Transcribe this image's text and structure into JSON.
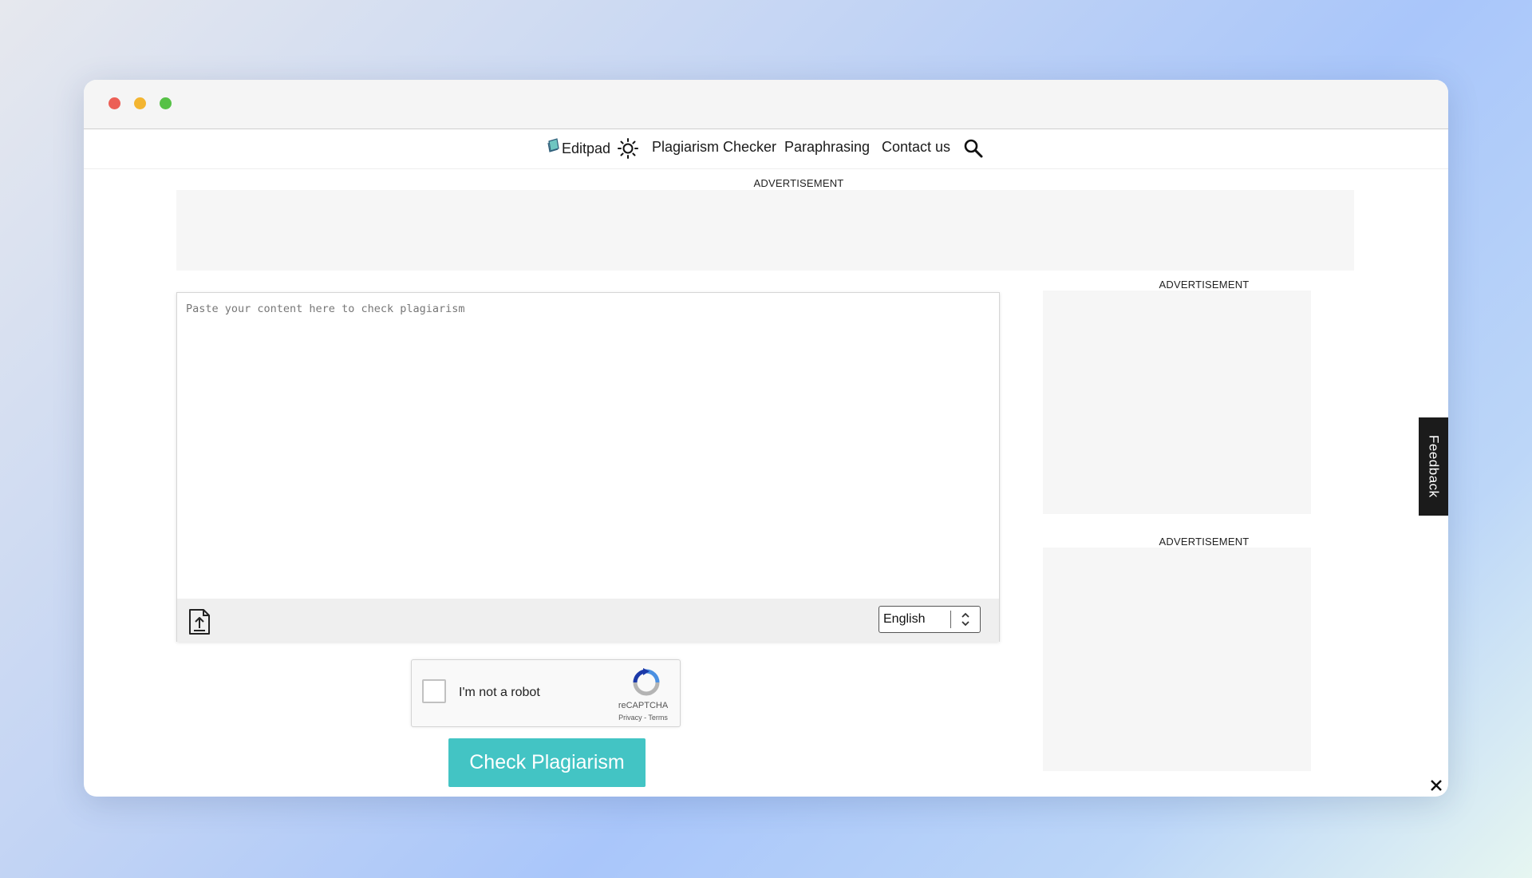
{
  "nav": {
    "logo_text": "Editpad",
    "plagiarism_checker": "Plagiarism Checker",
    "paraphrasing": "Paraphrasing",
    "contact_us": "Contact us"
  },
  "ads": {
    "top_label": "ADVERTISEMENT",
    "side_label_1": "ADVERTISEMENT",
    "side_label_2": "ADVERTISEMENT"
  },
  "editor": {
    "placeholder": "Paste your content here to check plagiarism",
    "value": "",
    "language": "English"
  },
  "recaptcha": {
    "label": "I'm not a robot",
    "brand": "reCAPTCHA",
    "links": "Privacy - Terms"
  },
  "check_button": "Check Plagiarism",
  "feedback": "Feedback",
  "icons": {
    "theme": "sun-icon",
    "search": "search-icon",
    "upload": "upload-file-icon",
    "close": "close-icon"
  },
  "colors": {
    "accent": "#43c4c4",
    "feedback_bg": "#1b1b1b"
  }
}
